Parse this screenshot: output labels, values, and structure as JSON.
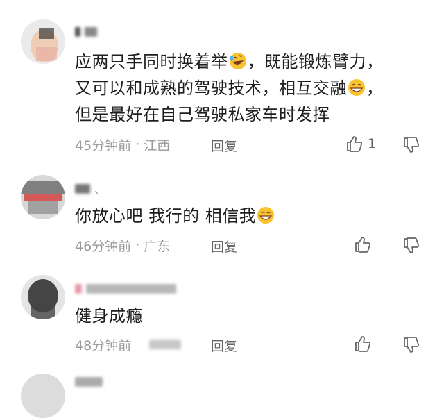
{
  "comments": [
    {
      "content_lines": [
        "应两只手同时换着举",
        "，既能锻炼臂力，",
        "又可以和成熟的驾驶技术，相互交融",
        "，",
        "但是最好在自己驾驶私家车时发挥"
      ],
      "time": "45分钟前",
      "separator": "·",
      "location": "江西",
      "reply_label": "回复",
      "like_count": "1"
    },
    {
      "username_suffix": "、",
      "content_text": "你放心吧  我行的  相信我",
      "time": "46分钟前",
      "separator": "·",
      "location": "广东",
      "reply_label": "回复"
    },
    {
      "content_text": "健身成瘾",
      "time": "48分钟前",
      "reply_label": "回复"
    }
  ],
  "icons": [
    "rofl-emoji-icon",
    "grin-emoji-icon",
    "thumbs-up-icon",
    "thumbs-down-icon"
  ],
  "colors": {
    "text": "#1e1e1e",
    "meta": "#999999",
    "action": "#666666",
    "emoji": "#f7c331"
  }
}
